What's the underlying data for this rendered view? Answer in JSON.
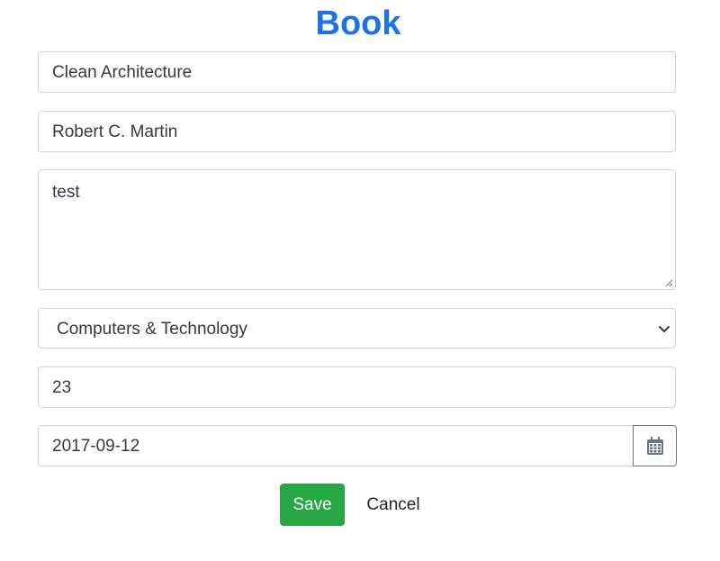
{
  "page": {
    "title": "Book"
  },
  "form": {
    "title_value": "Clean Architecture",
    "author_value": "Robert C. Martin",
    "description_value": "test",
    "category_selected": "Computers & Technology",
    "quantity_value": "23",
    "date_value": "2017-09-12"
  },
  "actions": {
    "save_label": "Save",
    "cancel_label": "Cancel"
  },
  "colors": {
    "title": "#1a73e8",
    "save_button": "#28a745",
    "border": "#ced4da"
  },
  "icons": {
    "select": "chevron-down-icon",
    "date": "calendar-icon"
  }
}
